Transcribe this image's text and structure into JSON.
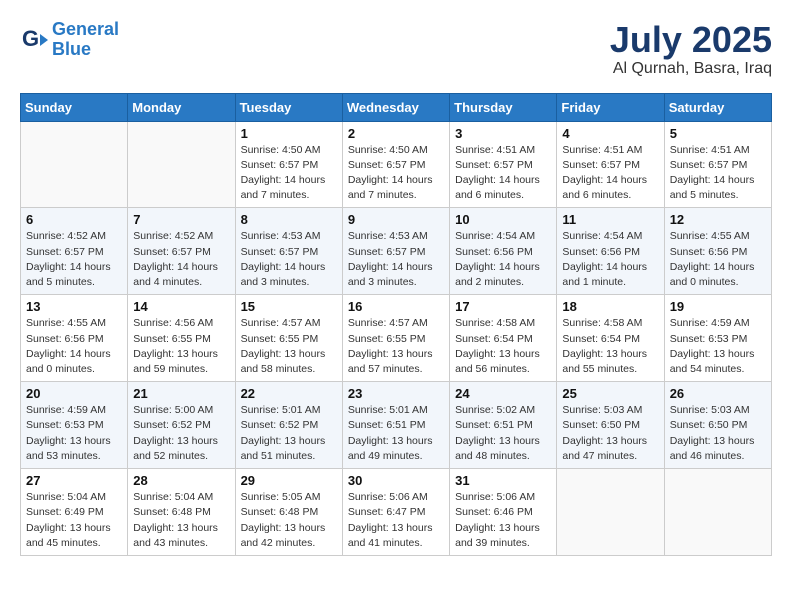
{
  "header": {
    "logo_line1": "General",
    "logo_line2": "Blue",
    "month_year": "July 2025",
    "location": "Al Qurnah, Basra, Iraq"
  },
  "weekdays": [
    "Sunday",
    "Monday",
    "Tuesday",
    "Wednesday",
    "Thursday",
    "Friday",
    "Saturday"
  ],
  "weeks": [
    [
      {
        "day": "",
        "info": ""
      },
      {
        "day": "",
        "info": ""
      },
      {
        "day": "1",
        "info": "Sunrise: 4:50 AM\nSunset: 6:57 PM\nDaylight: 14 hours\nand 7 minutes."
      },
      {
        "day": "2",
        "info": "Sunrise: 4:50 AM\nSunset: 6:57 PM\nDaylight: 14 hours\nand 7 minutes."
      },
      {
        "day": "3",
        "info": "Sunrise: 4:51 AM\nSunset: 6:57 PM\nDaylight: 14 hours\nand 6 minutes."
      },
      {
        "day": "4",
        "info": "Sunrise: 4:51 AM\nSunset: 6:57 PM\nDaylight: 14 hours\nand 6 minutes."
      },
      {
        "day": "5",
        "info": "Sunrise: 4:51 AM\nSunset: 6:57 PM\nDaylight: 14 hours\nand 5 minutes."
      }
    ],
    [
      {
        "day": "6",
        "info": "Sunrise: 4:52 AM\nSunset: 6:57 PM\nDaylight: 14 hours\nand 5 minutes."
      },
      {
        "day": "7",
        "info": "Sunrise: 4:52 AM\nSunset: 6:57 PM\nDaylight: 14 hours\nand 4 minutes."
      },
      {
        "day": "8",
        "info": "Sunrise: 4:53 AM\nSunset: 6:57 PM\nDaylight: 14 hours\nand 3 minutes."
      },
      {
        "day": "9",
        "info": "Sunrise: 4:53 AM\nSunset: 6:57 PM\nDaylight: 14 hours\nand 3 minutes."
      },
      {
        "day": "10",
        "info": "Sunrise: 4:54 AM\nSunset: 6:56 PM\nDaylight: 14 hours\nand 2 minutes."
      },
      {
        "day": "11",
        "info": "Sunrise: 4:54 AM\nSunset: 6:56 PM\nDaylight: 14 hours\nand 1 minute."
      },
      {
        "day": "12",
        "info": "Sunrise: 4:55 AM\nSunset: 6:56 PM\nDaylight: 14 hours\nand 0 minutes."
      }
    ],
    [
      {
        "day": "13",
        "info": "Sunrise: 4:55 AM\nSunset: 6:56 PM\nDaylight: 14 hours\nand 0 minutes."
      },
      {
        "day": "14",
        "info": "Sunrise: 4:56 AM\nSunset: 6:55 PM\nDaylight: 13 hours\nand 59 minutes."
      },
      {
        "day": "15",
        "info": "Sunrise: 4:57 AM\nSunset: 6:55 PM\nDaylight: 13 hours\nand 58 minutes."
      },
      {
        "day": "16",
        "info": "Sunrise: 4:57 AM\nSunset: 6:55 PM\nDaylight: 13 hours\nand 57 minutes."
      },
      {
        "day": "17",
        "info": "Sunrise: 4:58 AM\nSunset: 6:54 PM\nDaylight: 13 hours\nand 56 minutes."
      },
      {
        "day": "18",
        "info": "Sunrise: 4:58 AM\nSunset: 6:54 PM\nDaylight: 13 hours\nand 55 minutes."
      },
      {
        "day": "19",
        "info": "Sunrise: 4:59 AM\nSunset: 6:53 PM\nDaylight: 13 hours\nand 54 minutes."
      }
    ],
    [
      {
        "day": "20",
        "info": "Sunrise: 4:59 AM\nSunset: 6:53 PM\nDaylight: 13 hours\nand 53 minutes."
      },
      {
        "day": "21",
        "info": "Sunrise: 5:00 AM\nSunset: 6:52 PM\nDaylight: 13 hours\nand 52 minutes."
      },
      {
        "day": "22",
        "info": "Sunrise: 5:01 AM\nSunset: 6:52 PM\nDaylight: 13 hours\nand 51 minutes."
      },
      {
        "day": "23",
        "info": "Sunrise: 5:01 AM\nSunset: 6:51 PM\nDaylight: 13 hours\nand 49 minutes."
      },
      {
        "day": "24",
        "info": "Sunrise: 5:02 AM\nSunset: 6:51 PM\nDaylight: 13 hours\nand 48 minutes."
      },
      {
        "day": "25",
        "info": "Sunrise: 5:03 AM\nSunset: 6:50 PM\nDaylight: 13 hours\nand 47 minutes."
      },
      {
        "day": "26",
        "info": "Sunrise: 5:03 AM\nSunset: 6:50 PM\nDaylight: 13 hours\nand 46 minutes."
      }
    ],
    [
      {
        "day": "27",
        "info": "Sunrise: 5:04 AM\nSunset: 6:49 PM\nDaylight: 13 hours\nand 45 minutes."
      },
      {
        "day": "28",
        "info": "Sunrise: 5:04 AM\nSunset: 6:48 PM\nDaylight: 13 hours\nand 43 minutes."
      },
      {
        "day": "29",
        "info": "Sunrise: 5:05 AM\nSunset: 6:48 PM\nDaylight: 13 hours\nand 42 minutes."
      },
      {
        "day": "30",
        "info": "Sunrise: 5:06 AM\nSunset: 6:47 PM\nDaylight: 13 hours\nand 41 minutes."
      },
      {
        "day": "31",
        "info": "Sunrise: 5:06 AM\nSunset: 6:46 PM\nDaylight: 13 hours\nand 39 minutes."
      },
      {
        "day": "",
        "info": ""
      },
      {
        "day": "",
        "info": ""
      }
    ]
  ]
}
